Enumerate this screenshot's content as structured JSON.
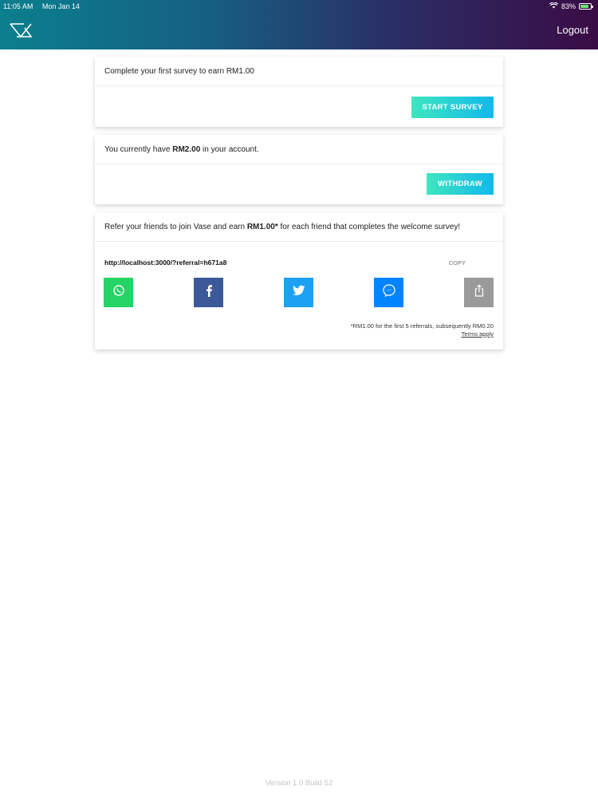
{
  "status": {
    "time": "11:05 AM",
    "date": "Mon Jan 14",
    "battery": "83%",
    "battery_level": 0.83
  },
  "header": {
    "logout_label": "Logout"
  },
  "survey_card": {
    "text": "Complete your first survey to earn RM1.00",
    "button_label": "START SURVEY"
  },
  "balance_card": {
    "text_before": "You currently have ",
    "amount": "RM2.00",
    "text_after": " in your account.",
    "button_label": "WITHDRAW"
  },
  "referral_card": {
    "text_before": "Refer your friends to join Vase and earn ",
    "amount": "RM1.00*",
    "text_after": " for each friend that completes the welcome survey!",
    "link": "http://localhost:3000/?referral=h671a8",
    "copy_label": "COPY",
    "share_buttons": [
      {
        "name": "whatsapp-icon",
        "color": "#25d366"
      },
      {
        "name": "facebook-icon",
        "color": "#3b5998"
      },
      {
        "name": "twitter-icon",
        "color": "#1da1f2"
      },
      {
        "name": "messenger-icon",
        "color": "#0084ff"
      },
      {
        "name": "share-icon",
        "color": "#9a9a9a"
      }
    ],
    "footnote": "*RM1.00 for the first 5 referrals, subsequently RM0.20",
    "terms_label": "Terms apply"
  },
  "footer": {
    "version": "Version 1.0 Build 52"
  }
}
